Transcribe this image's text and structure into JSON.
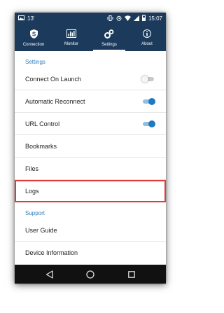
{
  "status_bar": {
    "left_indicator": "13'",
    "time": "15:07",
    "icons": [
      "picture-icon",
      "vibrate-icon",
      "alarm-icon",
      "wifi-icon",
      "signal-icon",
      "battery-icon"
    ]
  },
  "tabs": [
    {
      "label": "Connection",
      "icon": "shield-s-icon",
      "active": false
    },
    {
      "label": "Monitor",
      "icon": "bars-chart-icon",
      "active": false
    },
    {
      "label": "Settings",
      "icon": "gears-icon",
      "active": true
    },
    {
      "label": "About",
      "icon": "info-icon",
      "active": false
    }
  ],
  "sections": {
    "settings_header": "Settings",
    "support_header": "Support"
  },
  "settings_items": [
    {
      "label": "Connect On Launch",
      "toggle": false
    },
    {
      "label": "Automatic Reconnect",
      "toggle": true
    },
    {
      "label": "URL Control",
      "toggle": true
    },
    {
      "label": "Bookmarks"
    },
    {
      "label": "Files"
    },
    {
      "label": "Logs",
      "highlighted": true
    }
  ],
  "support_items": [
    {
      "label": "User Guide"
    },
    {
      "label": "Device Information"
    }
  ],
  "colors": {
    "header_bg": "#1c3b5c",
    "accent": "#2d7fbf",
    "toggle_on": "#1e7ac0",
    "highlight": "#e03a3a",
    "nav_bg": "#111111"
  },
  "nav_buttons": [
    "back-icon",
    "home-icon",
    "recents-icon"
  ]
}
